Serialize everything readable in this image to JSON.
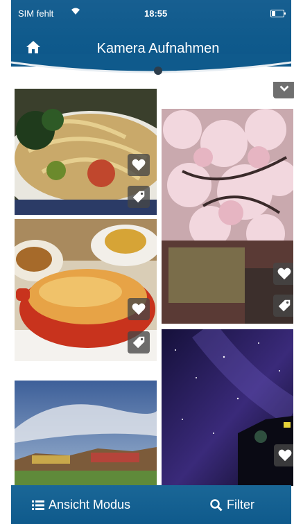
{
  "status": {
    "carrier": "SIM fehlt",
    "time": "18:55"
  },
  "header": {
    "title": "Kamera Aufnahmen"
  },
  "toolbar": {
    "view_mode_label": "Ansicht Modus",
    "filter_label": "Filter"
  },
  "colors": {
    "brand": "#0f5a8c",
    "overlay_button": "#4a4a4a"
  },
  "photos": [
    {
      "subject": "pasta dish"
    },
    {
      "subject": "cherry blossoms"
    },
    {
      "subject": "gratin dish"
    },
    {
      "subject": "starry night sky"
    },
    {
      "subject": "sky and hills landscape"
    }
  ],
  "icons": [
    "home-icon",
    "heart-icon",
    "tag-icon",
    "list-icon",
    "search-icon",
    "wifi-icon",
    "battery-icon"
  ]
}
